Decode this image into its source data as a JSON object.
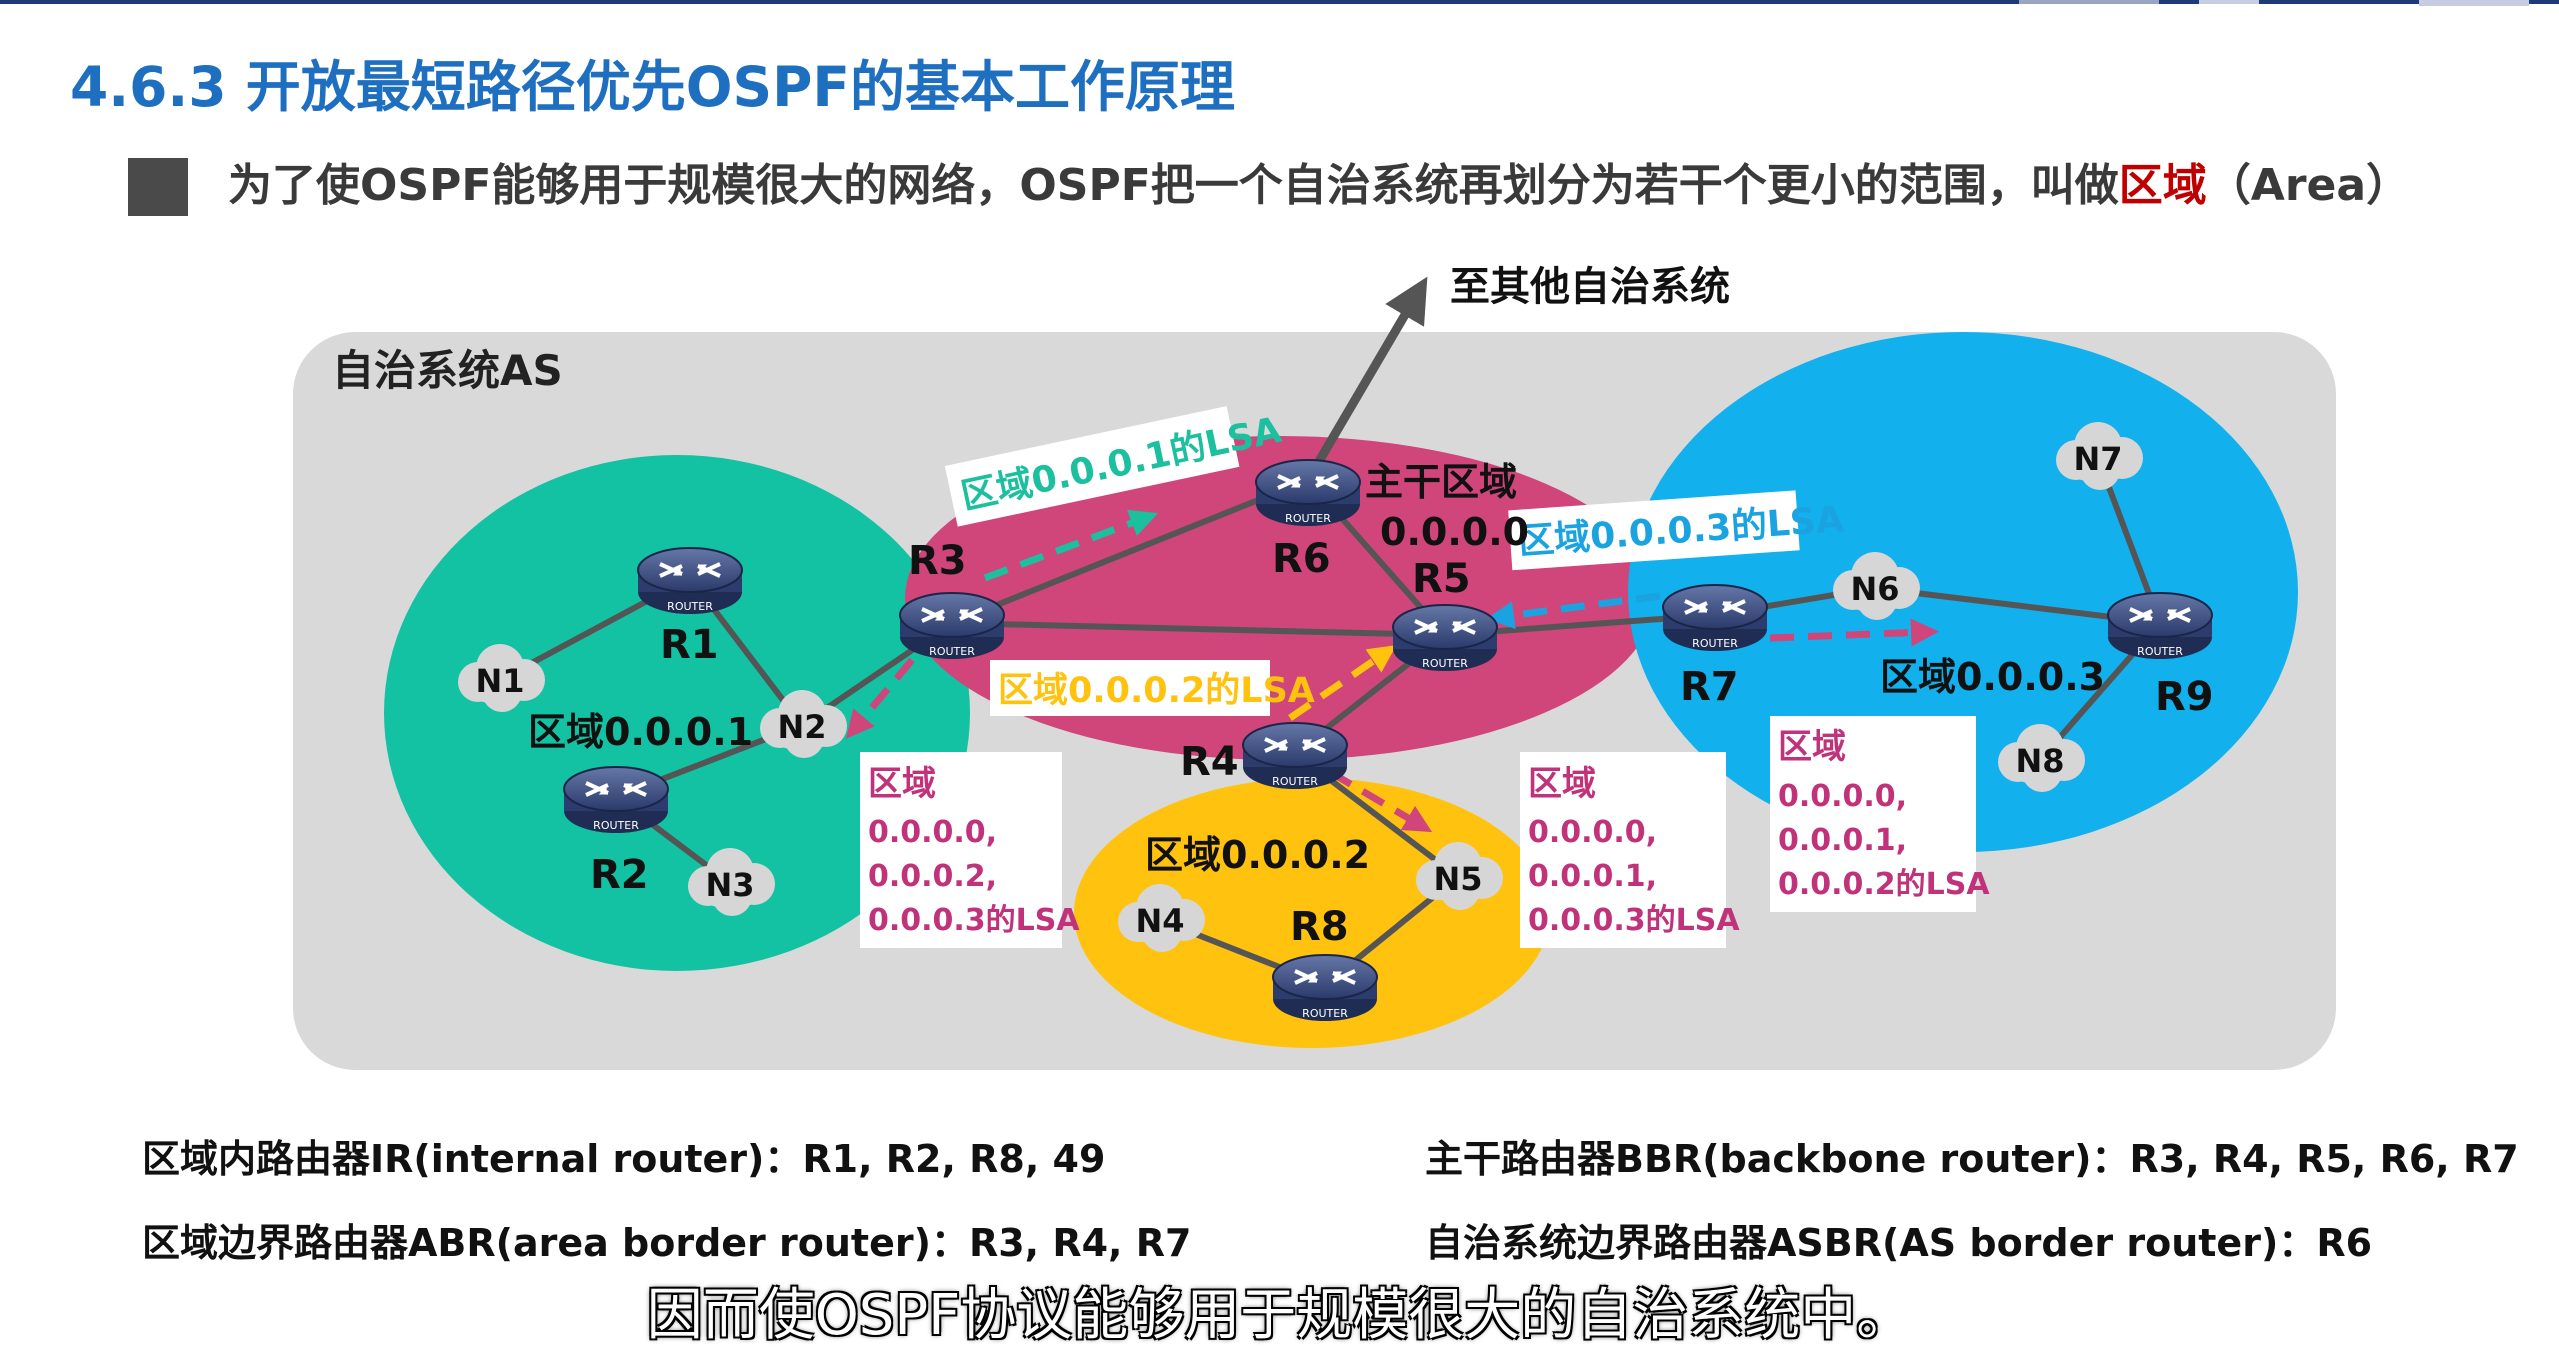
{
  "title": "4.6.3 开放最短路径优先OSPF的基本工作原理",
  "paragraph": {
    "text_before": "为了使OSPF能够用于规模很大的网络，OSPF把一个自治系统再划分为若干个更小的范围，叫做",
    "highlight": "区域",
    "text_after": "（Area）"
  },
  "diagram": {
    "as_label": "自治系统AS",
    "external_label": "至其他自治系统",
    "router_caption": "ROUTER",
    "areas": {
      "area1": "区域0.0.0.1",
      "backbone_line1": "主干区域",
      "backbone_line2": "0.0.0.0",
      "area2": "区域0.0.0.2",
      "area3": "区域0.0.0.3"
    },
    "routers": {
      "R1": "R1",
      "R2": "R2",
      "R3": "R3",
      "R4": "R4",
      "R5": "R5",
      "R6": "R6",
      "R7": "R7",
      "R8": "R8",
      "R9": "R9"
    },
    "networks": {
      "N1": "N1",
      "N2": "N2",
      "N3": "N3",
      "N4": "N4",
      "N5": "N5",
      "N6": "N6",
      "N7": "N7",
      "N8": "N8"
    },
    "lsa_labels": {
      "area1_lsa": "区域0.0.0.1的LSA",
      "area2_lsa": "区域0.0.0.2的LSA",
      "area3_lsa": "区域0.0.0.3的LSA"
    },
    "boxes": {
      "box_area1": [
        "区域",
        "0.0.0.0,",
        "0.0.0.2,",
        "0.0.0.3的LSA"
      ],
      "box_area2": [
        "区域",
        "0.0.0.0,",
        "0.0.0.1,",
        "0.0.0.3的LSA"
      ],
      "box_area3": [
        "区域",
        "0.0.0.0,",
        "0.0.0.1,",
        "0.0.0.2的LSA"
      ]
    }
  },
  "definitions": {
    "ir": "区域内路由器IR(internal router)：R1, R2, R8, 49",
    "bbr": "主干路由器BBR(backbone router)：R3, R4, R5, R6, R7",
    "abr": "区域边界路由器ABR(area border router)：R3, R4, R7",
    "asbr": "自治系统边界路由器ASBR(AS border router)：R6"
  },
  "subtitle": "因而使OSPF协议能够用于规模很大的自治系统中。",
  "colors": {
    "title": "#1e6fc0",
    "highlight": "#c00000",
    "area1": "#13c2a3",
    "backbone": "#d0457a",
    "area2": "#ffc20e",
    "area3": "#12b0ec",
    "as_background": "#d9d9d9",
    "lsa1_arrow": "#1cbf9e",
    "lsa2_arrow": "#ffc20e",
    "lsa3_arrow": "#1aa3e0",
    "box_text": "#c0327a"
  }
}
